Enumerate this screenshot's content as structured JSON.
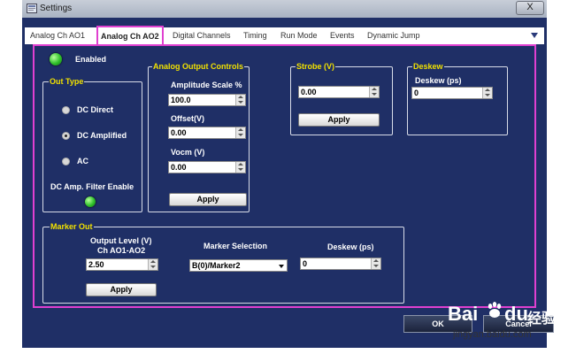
{
  "window": {
    "title": "Settings",
    "close_label": "X"
  },
  "tabs": [
    {
      "label": "Analog Ch AO1"
    },
    {
      "label": "Analog Ch AO2"
    },
    {
      "label": "Digital Channels"
    },
    {
      "label": "Timing"
    },
    {
      "label": "Run Mode"
    },
    {
      "label": "Events"
    },
    {
      "label": "Dynamic Jump"
    }
  ],
  "enabled": {
    "label": "Enabled",
    "state": true
  },
  "out_type": {
    "title": "Out Type",
    "options": [
      {
        "label": "DC Direct",
        "selected": false
      },
      {
        "label": "DC Amplified",
        "selected": true
      },
      {
        "label": "AC",
        "selected": false
      }
    ],
    "filter_label": "DC Amp. Filter Enable",
    "filter_state": true
  },
  "analog_output": {
    "title": "Analog Output Controls",
    "amplitude_label": "Amplitude Scale %",
    "amplitude_value": "100.0",
    "offset_label": "Offset(V)",
    "offset_value": "0.00",
    "vocm_label": "Vocm (V)",
    "vocm_value": "0.00",
    "apply_label": "Apply"
  },
  "strobe": {
    "title": "Strobe (V)",
    "value": "0.00",
    "apply_label": "Apply"
  },
  "deskew": {
    "title": "Deskew",
    "label": "Deskew (ps)",
    "value": "0"
  },
  "marker_out": {
    "title": "Marker Out",
    "output_level_label": "Output Level (V)",
    "channels_label": "Ch AO1-AO2",
    "output_level_value": "2.50",
    "marker_selection_label": "Marker Selection",
    "marker_selection_value": "B(0)/Marker2",
    "deskew_label": "Deskew (ps)",
    "deskew_value": "0",
    "apply_label": "Apply"
  },
  "footer": {
    "ok_label": "OK",
    "cancel_label": "Cancel"
  },
  "watermark": {
    "brand": "Bai",
    "brand2": "du",
    "cn": "经验",
    "url": "jingyan.baidu.com"
  },
  "colors": {
    "window_bg": "#1f2f66",
    "group_title": "#f0e000",
    "tab_highlight": "#e040d0",
    "led_on": "#2fc12a"
  }
}
